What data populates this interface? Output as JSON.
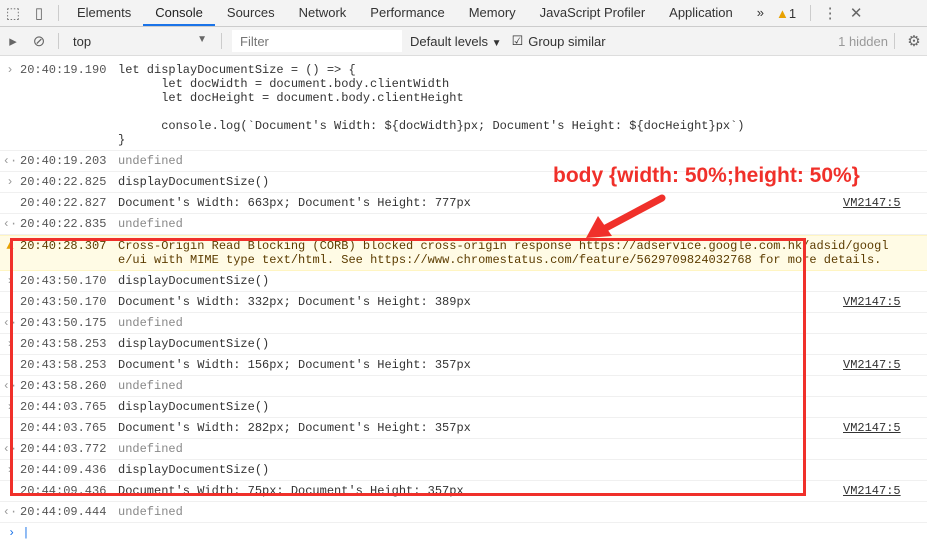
{
  "tabs": [
    "Elements",
    "Console",
    "Sources",
    "Network",
    "Performance",
    "Memory",
    "JavaScript Profiler",
    "Application"
  ],
  "warning_count": "1",
  "toolbar": {
    "context": "top",
    "filter_placeholder": "Filter",
    "levels": "Default levels",
    "group_similar": "Group similar",
    "hidden": "1 hidden"
  },
  "code": {
    "ts": "20:40:19.190",
    "lines": [
      "let displayDocumentSize = () => {",
      "      let docWidth = document.body.clientWidth",
      "      let docHeight = document.body.clientHeight",
      "",
      "      console.log(`Document's Width: ${docWidth}px; Document's Height: ${docHeight}px`)",
      "}"
    ]
  },
  "rows": [
    {
      "type": "out",
      "ts": "20:40:19.203",
      "msg": "undefined"
    },
    {
      "type": "in",
      "ts": "20:40:22.825",
      "msg": "displayDocumentSize()"
    },
    {
      "type": "log",
      "ts": "20:40:22.827",
      "msg": "Document's Width: 663px; Document's Height: 777px",
      "src": "VM2147:5"
    },
    {
      "type": "out",
      "ts": "20:40:22.835",
      "msg": "undefined"
    }
  ],
  "warning": {
    "ts": "20:40:28.307",
    "text1": "Cross-Origin Read Blocking (CORB) blocked cross-origin response ",
    "link1a": "https://adservice.google.com.hk/adsid/googl",
    "link1b": "e/ui",
    "text2": " with MIME type text/html. See ",
    "link2": "https://www.chromestatus.com/feature/5629709824032768",
    "text3": " for more details."
  },
  "rows2": [
    {
      "type": "in",
      "ts": "20:43:50.170",
      "msg": "displayDocumentSize()"
    },
    {
      "type": "log",
      "ts": "20:43:50.170",
      "msg": "Document's Width: 332px; Document's Height: 389px",
      "src": "VM2147:5"
    },
    {
      "type": "out",
      "ts": "20:43:50.175",
      "msg": "undefined"
    },
    {
      "type": "in",
      "ts": "20:43:58.253",
      "msg": "displayDocumentSize()"
    },
    {
      "type": "log",
      "ts": "20:43:58.253",
      "msg": "Document's Width: 156px; Document's Height: 357px",
      "src": "VM2147:5"
    },
    {
      "type": "out",
      "ts": "20:43:58.260",
      "msg": "undefined"
    },
    {
      "type": "in",
      "ts": "20:44:03.765",
      "msg": "displayDocumentSize()"
    },
    {
      "type": "log",
      "ts": "20:44:03.765",
      "msg": "Document's Width: 282px; Document's Height: 357px",
      "src": "VM2147:5"
    },
    {
      "type": "out",
      "ts": "20:44:03.772",
      "msg": "undefined"
    },
    {
      "type": "in",
      "ts": "20:44:09.436",
      "msg": "displayDocumentSize()"
    },
    {
      "type": "log",
      "ts": "20:44:09.436",
      "msg": "Document's Width: 75px; Document's Height: 357px",
      "src": "VM2147:5"
    },
    {
      "type": "out",
      "ts": "20:44:09.444",
      "msg": "undefined"
    }
  ],
  "annotation": "body {width: 50%;height: 50%}",
  "colors": {
    "annotation": "#f0302a",
    "accent": "#1a73e8"
  }
}
